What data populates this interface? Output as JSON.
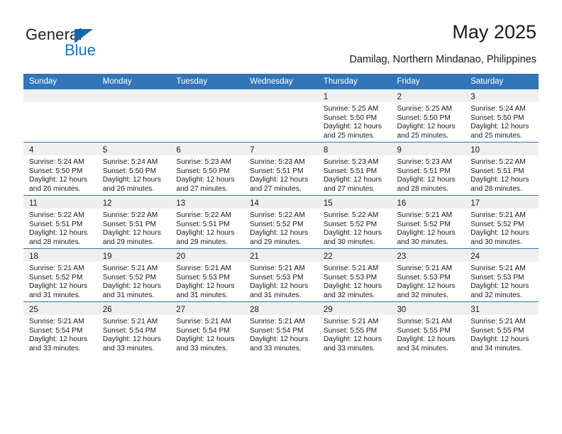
{
  "brand": {
    "name_part1": "General",
    "name_part2": "Blue",
    "accent_color": "#1479c4",
    "triangle_color": "#1566b0"
  },
  "header": {
    "title": "May 2025",
    "subtitle": "Damilag, Northern Mindanao, Philippines"
  },
  "calendar": {
    "header_bg": "#3376b8",
    "daynum_bg": "#efefef",
    "weekday_headers": [
      "Sunday",
      "Monday",
      "Tuesday",
      "Wednesday",
      "Thursday",
      "Friday",
      "Saturday"
    ],
    "weeks": [
      [
        {
          "day": "",
          "sunrise": "",
          "sunset": "",
          "daylight": ""
        },
        {
          "day": "",
          "sunrise": "",
          "sunset": "",
          "daylight": ""
        },
        {
          "day": "",
          "sunrise": "",
          "sunset": "",
          "daylight": ""
        },
        {
          "day": "",
          "sunrise": "",
          "sunset": "",
          "daylight": ""
        },
        {
          "day": "1",
          "sunrise": "Sunrise: 5:25 AM",
          "sunset": "Sunset: 5:50 PM",
          "daylight": "Daylight: 12 hours and 25 minutes."
        },
        {
          "day": "2",
          "sunrise": "Sunrise: 5:25 AM",
          "sunset": "Sunset: 5:50 PM",
          "daylight": "Daylight: 12 hours and 25 minutes."
        },
        {
          "day": "3",
          "sunrise": "Sunrise: 5:24 AM",
          "sunset": "Sunset: 5:50 PM",
          "daylight": "Daylight: 12 hours and 25 minutes."
        }
      ],
      [
        {
          "day": "4",
          "sunrise": "Sunrise: 5:24 AM",
          "sunset": "Sunset: 5:50 PM",
          "daylight": "Daylight: 12 hours and 26 minutes."
        },
        {
          "day": "5",
          "sunrise": "Sunrise: 5:24 AM",
          "sunset": "Sunset: 5:50 PM",
          "daylight": "Daylight: 12 hours and 26 minutes."
        },
        {
          "day": "6",
          "sunrise": "Sunrise: 5:23 AM",
          "sunset": "Sunset: 5:50 PM",
          "daylight": "Daylight: 12 hours and 27 minutes."
        },
        {
          "day": "7",
          "sunrise": "Sunrise: 5:23 AM",
          "sunset": "Sunset: 5:51 PM",
          "daylight": "Daylight: 12 hours and 27 minutes."
        },
        {
          "day": "8",
          "sunrise": "Sunrise: 5:23 AM",
          "sunset": "Sunset: 5:51 PM",
          "daylight": "Daylight: 12 hours and 27 minutes."
        },
        {
          "day": "9",
          "sunrise": "Sunrise: 5:23 AM",
          "sunset": "Sunset: 5:51 PM",
          "daylight": "Daylight: 12 hours and 28 minutes."
        },
        {
          "day": "10",
          "sunrise": "Sunrise: 5:22 AM",
          "sunset": "Sunset: 5:51 PM",
          "daylight": "Daylight: 12 hours and 28 minutes."
        }
      ],
      [
        {
          "day": "11",
          "sunrise": "Sunrise: 5:22 AM",
          "sunset": "Sunset: 5:51 PM",
          "daylight": "Daylight: 12 hours and 28 minutes."
        },
        {
          "day": "12",
          "sunrise": "Sunrise: 5:22 AM",
          "sunset": "Sunset: 5:51 PM",
          "daylight": "Daylight: 12 hours and 29 minutes."
        },
        {
          "day": "13",
          "sunrise": "Sunrise: 5:22 AM",
          "sunset": "Sunset: 5:51 PM",
          "daylight": "Daylight: 12 hours and 29 minutes."
        },
        {
          "day": "14",
          "sunrise": "Sunrise: 5:22 AM",
          "sunset": "Sunset: 5:52 PM",
          "daylight": "Daylight: 12 hours and 29 minutes."
        },
        {
          "day": "15",
          "sunrise": "Sunrise: 5:22 AM",
          "sunset": "Sunset: 5:52 PM",
          "daylight": "Daylight: 12 hours and 30 minutes."
        },
        {
          "day": "16",
          "sunrise": "Sunrise: 5:21 AM",
          "sunset": "Sunset: 5:52 PM",
          "daylight": "Daylight: 12 hours and 30 minutes."
        },
        {
          "day": "17",
          "sunrise": "Sunrise: 5:21 AM",
          "sunset": "Sunset: 5:52 PM",
          "daylight": "Daylight: 12 hours and 30 minutes."
        }
      ],
      [
        {
          "day": "18",
          "sunrise": "Sunrise: 5:21 AM",
          "sunset": "Sunset: 5:52 PM",
          "daylight": "Daylight: 12 hours and 31 minutes."
        },
        {
          "day": "19",
          "sunrise": "Sunrise: 5:21 AM",
          "sunset": "Sunset: 5:52 PM",
          "daylight": "Daylight: 12 hours and 31 minutes."
        },
        {
          "day": "20",
          "sunrise": "Sunrise: 5:21 AM",
          "sunset": "Sunset: 5:53 PM",
          "daylight": "Daylight: 12 hours and 31 minutes."
        },
        {
          "day": "21",
          "sunrise": "Sunrise: 5:21 AM",
          "sunset": "Sunset: 5:53 PM",
          "daylight": "Daylight: 12 hours and 31 minutes."
        },
        {
          "day": "22",
          "sunrise": "Sunrise: 5:21 AM",
          "sunset": "Sunset: 5:53 PM",
          "daylight": "Daylight: 12 hours and 32 minutes."
        },
        {
          "day": "23",
          "sunrise": "Sunrise: 5:21 AM",
          "sunset": "Sunset: 5:53 PM",
          "daylight": "Daylight: 12 hours and 32 minutes."
        },
        {
          "day": "24",
          "sunrise": "Sunrise: 5:21 AM",
          "sunset": "Sunset: 5:53 PM",
          "daylight": "Daylight: 12 hours and 32 minutes."
        }
      ],
      [
        {
          "day": "25",
          "sunrise": "Sunrise: 5:21 AM",
          "sunset": "Sunset: 5:54 PM",
          "daylight": "Daylight: 12 hours and 33 minutes."
        },
        {
          "day": "26",
          "sunrise": "Sunrise: 5:21 AM",
          "sunset": "Sunset: 5:54 PM",
          "daylight": "Daylight: 12 hours and 33 minutes."
        },
        {
          "day": "27",
          "sunrise": "Sunrise: 5:21 AM",
          "sunset": "Sunset: 5:54 PM",
          "daylight": "Daylight: 12 hours and 33 minutes."
        },
        {
          "day": "28",
          "sunrise": "Sunrise: 5:21 AM",
          "sunset": "Sunset: 5:54 PM",
          "daylight": "Daylight: 12 hours and 33 minutes."
        },
        {
          "day": "29",
          "sunrise": "Sunrise: 5:21 AM",
          "sunset": "Sunset: 5:55 PM",
          "daylight": "Daylight: 12 hours and 33 minutes."
        },
        {
          "day": "30",
          "sunrise": "Sunrise: 5:21 AM",
          "sunset": "Sunset: 5:55 PM",
          "daylight": "Daylight: 12 hours and 34 minutes."
        },
        {
          "day": "31",
          "sunrise": "Sunrise: 5:21 AM",
          "sunset": "Sunset: 5:55 PM",
          "daylight": "Daylight: 12 hours and 34 minutes."
        }
      ]
    ]
  }
}
